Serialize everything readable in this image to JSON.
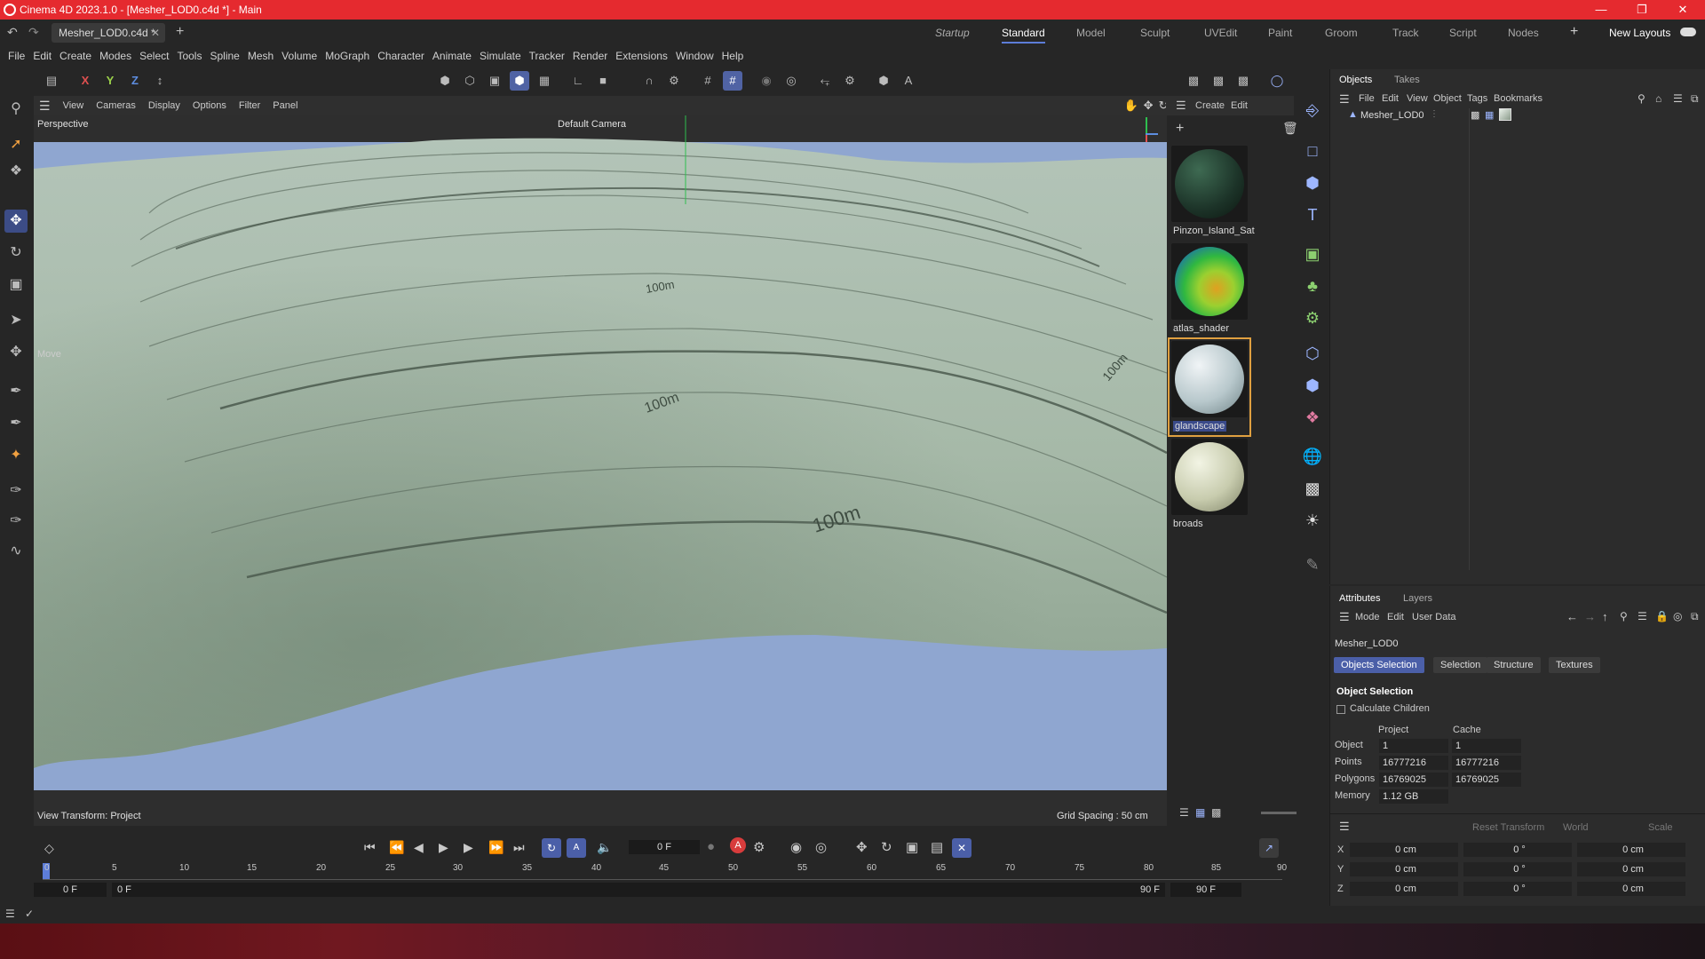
{
  "window": {
    "title": "Cinema 4D 2023.1.0 - [Mesher_LOD0.c4d *] - Main"
  },
  "doc_tab": {
    "name": "Mesher_LOD0.c4d *"
  },
  "layouts": [
    "Startup",
    "Standard",
    "Model",
    "Sculpt",
    "UVEdit",
    "Paint",
    "Groom",
    "Track",
    "Script",
    "Nodes"
  ],
  "layouts_active": "Standard",
  "new_layouts": "New Layouts",
  "menu": [
    "File",
    "Edit",
    "Create",
    "Modes",
    "Select",
    "Tools",
    "Spline",
    "Mesh",
    "Volume",
    "MoGraph",
    "Character",
    "Animate",
    "Simulate",
    "Tracker",
    "Render",
    "Extensions",
    "Window",
    "Help"
  ],
  "axis_toggles": [
    "X",
    "Y",
    "Z"
  ],
  "viewport": {
    "menu": [
      "View",
      "Cameras",
      "Display",
      "Options",
      "Filter",
      "Panel"
    ],
    "projection": "Perspective",
    "camera": "Default Camera",
    "tool_label": "Move",
    "view_transform": "View Transform: Project",
    "grid_spacing": "Grid Spacing : 50 cm",
    "contour_labels": [
      "100m",
      "100m",
      "100m",
      "100m"
    ]
  },
  "materials": {
    "menu": [
      "Create",
      "Edit"
    ],
    "items": [
      {
        "name": "Pinzon_Island_Sat"
      },
      {
        "name": "atlas_shader"
      },
      {
        "name": "glandscape"
      },
      {
        "name": "broads"
      }
    ],
    "selected": "glandscape"
  },
  "objects": {
    "tabs": [
      "Objects",
      "Takes"
    ],
    "menu": [
      "File",
      "Edit",
      "View",
      "Object",
      "Tags",
      "Bookmarks"
    ],
    "items": [
      {
        "name": "Mesher_LOD0"
      }
    ]
  },
  "attributes": {
    "tabs": [
      "Attributes",
      "Layers"
    ],
    "menu": [
      "Mode",
      "Edit",
      "User Data"
    ],
    "object_name": "Mesher_LOD0",
    "subtabs": [
      "Objects Selection",
      "Selection",
      "Structure",
      "Textures"
    ],
    "active_subtab": "Objects Selection",
    "section": "Object Selection",
    "calculate_children": "Calculate Children",
    "columns": [
      "Project",
      "Cache"
    ],
    "rows": [
      {
        "label": "Object",
        "project": "1",
        "cache": "1"
      },
      {
        "label": "Points",
        "project": "16777216",
        "cache": "16777216"
      },
      {
        "label": "Polygons",
        "project": "16769025",
        "cache": "16769025"
      },
      {
        "label": "Memory",
        "project": "1.12 GB",
        "cache": ""
      }
    ]
  },
  "coords": {
    "reset": "Reset Transform",
    "space": "World",
    "mode": "Scale",
    "rows": [
      {
        "axis": "X",
        "pos": "0 cm",
        "rot": "0 °",
        "scale": "0 cm"
      },
      {
        "axis": "Y",
        "pos": "0 cm",
        "rot": "0 °",
        "scale": "0 cm"
      },
      {
        "axis": "Z",
        "pos": "0 cm",
        "rot": "0 °",
        "scale": "0 cm"
      }
    ]
  },
  "timeline": {
    "current_frame": "0 F",
    "ruler": [
      "0",
      "5",
      "10",
      "15",
      "20",
      "25",
      "30",
      "35",
      "40",
      "45",
      "50",
      "55",
      "60",
      "65",
      "70",
      "75",
      "80",
      "85",
      "90"
    ],
    "start": "0 F",
    "start2": "0 F",
    "end": "90 F",
    "end2": "90 F"
  }
}
